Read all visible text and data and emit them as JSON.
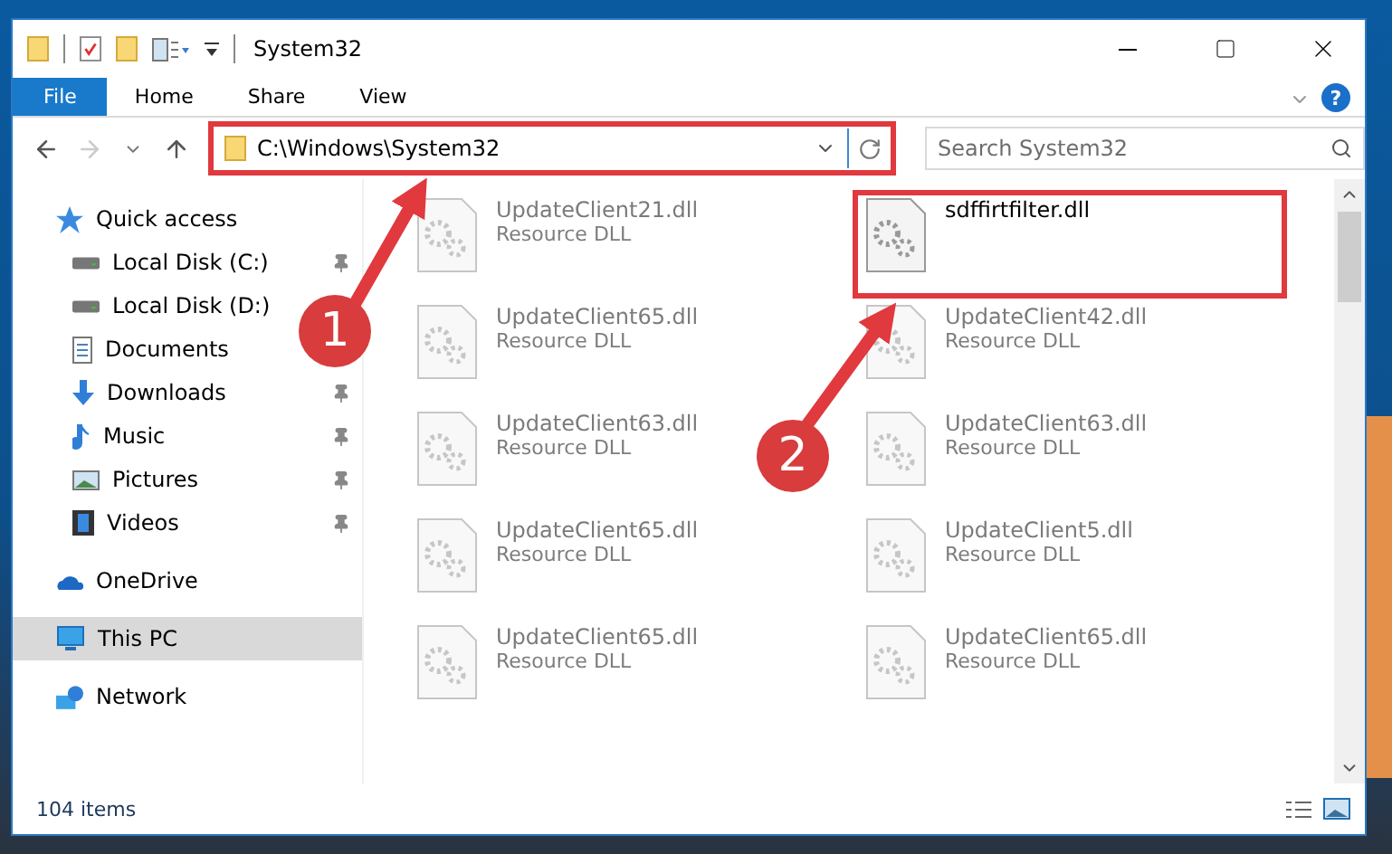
{
  "window": {
    "title": "System32"
  },
  "ribbon": {
    "tabs": [
      {
        "label": "File",
        "kind": "file"
      },
      {
        "label": "Home",
        "kind": "tab"
      },
      {
        "label": "Share",
        "kind": "tab"
      },
      {
        "label": "View",
        "kind": "tab"
      }
    ],
    "help": "?"
  },
  "navigation": {
    "back_enabled": true,
    "forward_enabled": false
  },
  "address": {
    "value": "C:\\Windows\\System32",
    "highlighted": true
  },
  "search": {
    "placeholder": "Search System32"
  },
  "sidebar": {
    "items": [
      {
        "label": "Quick access",
        "kind": "star",
        "selected": false,
        "children": [
          {
            "label": "Local Disk (C:)",
            "kind": "disk",
            "pinned": true
          },
          {
            "label": "Local Disk (D:)",
            "kind": "disk",
            "pinned": false
          },
          {
            "label": "Documents",
            "kind": "document",
            "pinned": false
          },
          {
            "label": "Downloads",
            "kind": "download",
            "pinned": true
          },
          {
            "label": "Music",
            "kind": "music",
            "pinned": true
          },
          {
            "label": "Pictures",
            "kind": "pictures",
            "pinned": true
          },
          {
            "label": "Videos",
            "kind": "video",
            "pinned": true
          }
        ]
      },
      {
        "label": "OneDrive",
        "kind": "cloud",
        "selected": false
      },
      {
        "label": "This PC",
        "kind": "computer",
        "selected": true
      },
      {
        "label": "Network",
        "kind": "network",
        "selected": false
      }
    ]
  },
  "files": [
    {
      "name": "UpdateClient21.dll",
      "type": "Resource DLL",
      "blurred": true,
      "highlighted": false
    },
    {
      "name": "sdffirtfilter.dll",
      "blurred": false,
      "highlighted": true
    },
    {
      "name": "UpdateClient65.dll",
      "type": "Resource DLL",
      "blurred": true,
      "highlighted": false
    },
    {
      "name": "UpdateClient42.dll",
      "type": "Resource DLL",
      "blurred": true,
      "highlighted": false
    },
    {
      "name": "UpdateClient63.dll",
      "type": "Resource DLL",
      "blurred": true,
      "highlighted": false
    },
    {
      "name": "UpdateClient63.dll",
      "type": "Resource DLL",
      "blurred": true,
      "highlighted": false
    },
    {
      "name": "UpdateClient65.dll",
      "type": "Resource DLL",
      "blurred": true,
      "highlighted": false
    },
    {
      "name": "UpdateClient5.dll",
      "type": "Resource DLL",
      "blurred": true,
      "highlighted": false
    },
    {
      "name": "UpdateClient65.dll",
      "type": "Resource DLL",
      "blurred": true,
      "highlighted": false
    },
    {
      "name": "UpdateClient65.dll",
      "type": "Resource DLL",
      "blurred": true,
      "highlighted": false
    }
  ],
  "status_bar": {
    "count": "104 items"
  },
  "annotations": [
    {
      "label": "1"
    },
    {
      "label": "2"
    }
  ]
}
